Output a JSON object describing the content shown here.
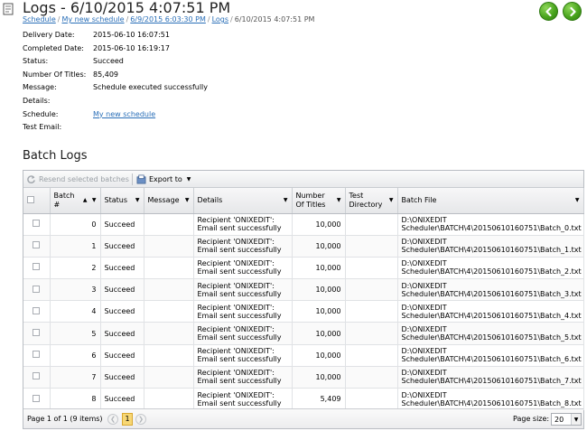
{
  "header": {
    "title": "Logs - 6/10/2015 4:07:51 PM",
    "breadcrumbs": [
      "Schedule",
      "My new schedule",
      "6/9/2015 6:03:30 PM",
      "Logs",
      "6/10/2015 4:07:51 PM"
    ],
    "separator": "/",
    "back_icon": "arrow-left-icon",
    "forward_icon": "arrow-right-icon"
  },
  "info": [
    {
      "label": "Delivery Date:",
      "value": "2015-06-10 16:07:51"
    },
    {
      "label": "Completed Date:",
      "value": "2015-06-10 16:19:17"
    },
    {
      "label": "Status:",
      "value": "Succeed"
    },
    {
      "label": "Number Of Titles:",
      "value": "85,409"
    },
    {
      "label": "Message:",
      "value": "Schedule executed successfully"
    },
    {
      "label": "Details:",
      "value": ""
    },
    {
      "label": "Schedule:",
      "value": "My new schedule"
    },
    {
      "label": "Test Email:",
      "value": ""
    }
  ],
  "batch_logs": {
    "title": "Batch Logs",
    "toolbar": {
      "resend_label": "Resend selected batches",
      "export_label": "Export to"
    },
    "columns": [
      "",
      "Batch #",
      "Status",
      "Message",
      "Details",
      "Number Of Titles",
      "Test Directory",
      "Batch File"
    ],
    "rows": [
      {
        "batch": "0",
        "status": "Succeed",
        "message": "",
        "details1": "Recipient 'ONIXEDIT':",
        "details2": "Email sent successfully",
        "titles": "10,000",
        "test_dir": "",
        "file1": "D:\\ONIXEDIT",
        "file2": "Scheduler\\BATCH\\4\\20150610160751\\Batch_0.txt"
      },
      {
        "batch": "1",
        "status": "Succeed",
        "message": "",
        "details1": "Recipient 'ONIXEDIT':",
        "details2": "Email sent successfully",
        "titles": "10,000",
        "test_dir": "",
        "file1": "D:\\ONIXEDIT",
        "file2": "Scheduler\\BATCH\\4\\20150610160751\\Batch_1.txt"
      },
      {
        "batch": "2",
        "status": "Succeed",
        "message": "",
        "details1": "Recipient 'ONIXEDIT':",
        "details2": "Email sent successfully",
        "titles": "10,000",
        "test_dir": "",
        "file1": "D:\\ONIXEDIT",
        "file2": "Scheduler\\BATCH\\4\\20150610160751\\Batch_2.txt"
      },
      {
        "batch": "3",
        "status": "Succeed",
        "message": "",
        "details1": "Recipient 'ONIXEDIT':",
        "details2": "Email sent successfully",
        "titles": "10,000",
        "test_dir": "",
        "file1": "D:\\ONIXEDIT",
        "file2": "Scheduler\\BATCH\\4\\20150610160751\\Batch_3.txt"
      },
      {
        "batch": "4",
        "status": "Succeed",
        "message": "",
        "details1": "Recipient 'ONIXEDIT':",
        "details2": "Email sent successfully",
        "titles": "10,000",
        "test_dir": "",
        "file1": "D:\\ONIXEDIT",
        "file2": "Scheduler\\BATCH\\4\\20150610160751\\Batch_4.txt"
      },
      {
        "batch": "5",
        "status": "Succeed",
        "message": "",
        "details1": "Recipient 'ONIXEDIT':",
        "details2": "Email sent successfully",
        "titles": "10,000",
        "test_dir": "",
        "file1": "D:\\ONIXEDIT",
        "file2": "Scheduler\\BATCH\\4\\20150610160751\\Batch_5.txt"
      },
      {
        "batch": "6",
        "status": "Succeed",
        "message": "",
        "details1": "Recipient 'ONIXEDIT':",
        "details2": "Email sent successfully",
        "titles": "10,000",
        "test_dir": "",
        "file1": "D:\\ONIXEDIT",
        "file2": "Scheduler\\BATCH\\4\\20150610160751\\Batch_6.txt"
      },
      {
        "batch": "7",
        "status": "Succeed",
        "message": "",
        "details1": "Recipient 'ONIXEDIT':",
        "details2": "Email sent successfully",
        "titles": "10,000",
        "test_dir": "",
        "file1": "D:\\ONIXEDIT",
        "file2": "Scheduler\\BATCH\\4\\20150610160751\\Batch_7.txt"
      },
      {
        "batch": "8",
        "status": "Succeed",
        "message": "",
        "details1": "Recipient 'ONIXEDIT':",
        "details2": "Email sent successfully",
        "titles": "5,409",
        "test_dir": "",
        "file1": "D:\\ONIXEDIT",
        "file2": "Scheduler\\BATCH\\4\\20150610160751\\Batch_8.txt"
      }
    ],
    "pager": {
      "info": "Page 1 of 1 (9 items)",
      "current_page": "1",
      "page_size_label": "Page size:",
      "page_size": "20"
    }
  },
  "colors": {
    "link": "#2a6fb8",
    "nav_green": "#4aa51e",
    "current_page": "#f7d774"
  }
}
